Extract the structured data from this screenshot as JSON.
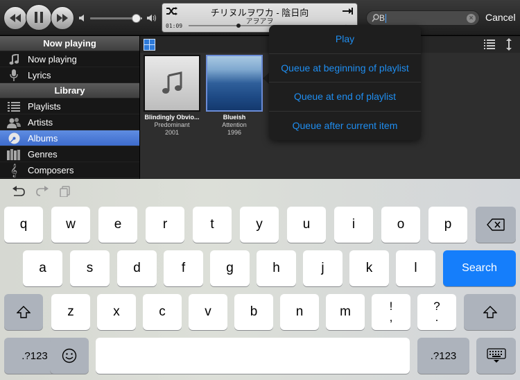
{
  "toolbar": {
    "now_playing": {
      "title": "チリヌルヲワカ - 陰日向",
      "artist": "アヲアヲ",
      "elapsed": "01:09",
      "remaining": "~~:~~"
    },
    "search": {
      "value": "B",
      "placeholder": ""
    },
    "cancel_label": "Cancel"
  },
  "sidebar": {
    "sections": [
      {
        "header": "Now playing",
        "items": [
          {
            "label": "Now playing",
            "icon": "music-note-icon"
          },
          {
            "label": "Lyrics",
            "icon": "microphone-icon"
          }
        ]
      },
      {
        "header": "Library",
        "items": [
          {
            "label": "Playlists",
            "icon": "list-icon"
          },
          {
            "label": "Artists",
            "icon": "people-icon"
          },
          {
            "label": "Albums",
            "icon": "disc-icon",
            "selected": true
          },
          {
            "label": "Genres",
            "icon": "genres-icon"
          },
          {
            "label": "Composers",
            "icon": "treble-clef-icon"
          }
        ]
      }
    ]
  },
  "albums": [
    {
      "title": "Blindingly Obvio...",
      "artist": "Predominant",
      "year": "2001",
      "cover": "placeholder-note"
    },
    {
      "title": "Blueish",
      "artist": "Attention",
      "year": "1996",
      "cover": "sea",
      "selected": true
    }
  ],
  "popover": {
    "items": [
      "Play",
      "Queue at beginning of playlist",
      "Queue at end of playlist",
      "Queue after current item"
    ]
  },
  "keyboard": {
    "row1": [
      "q",
      "w",
      "e",
      "r",
      "t",
      "y",
      "u",
      "i",
      "o",
      "p"
    ],
    "row2": [
      "a",
      "s",
      "d",
      "f",
      "g",
      "h",
      "j",
      "k",
      "l"
    ],
    "row3": [
      "z",
      "x",
      "c",
      "v",
      "b",
      "n",
      "m"
    ],
    "punct1": [
      "!",
      ","
    ],
    "punct2": [
      "?",
      "."
    ],
    "search_label": "Search",
    "numbers_label": ".?123"
  },
  "colors": {
    "accent": "#157efb",
    "popover_text": "#1f8ef1",
    "selection": "#4a78d6"
  }
}
